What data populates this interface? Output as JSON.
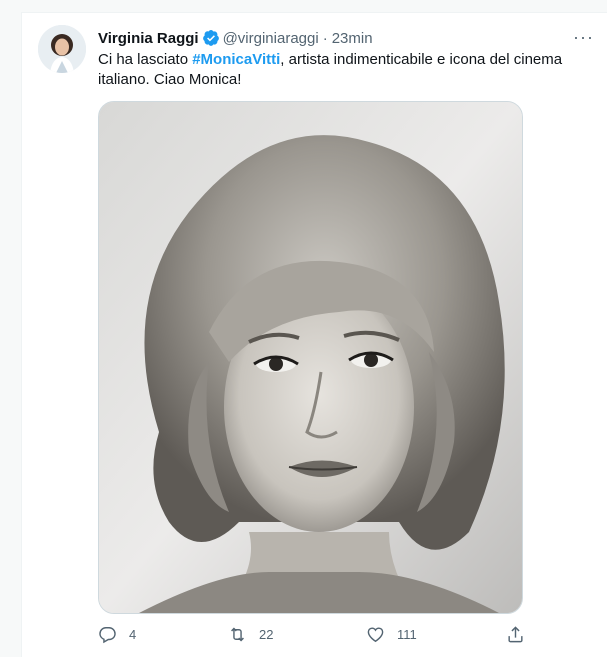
{
  "tweet": {
    "author_name": "Virginia Raggi",
    "author_handle": "@virginiaraggi",
    "separator": "·",
    "time": "23min",
    "text_before": "Ci ha lasciato ",
    "hashtag": "#MonicaVitti",
    "text_after": ", artista indimenticabile e icona del cinema italiano. Ciao Monica!",
    "media_icon": "photo-portrait-black-and-white",
    "more_label": "···"
  },
  "actions": {
    "reply_count": "4",
    "retweet_count": "22",
    "like_count": "111",
    "reply_icon": "reply-icon",
    "retweet_icon": "retweet-icon",
    "like_icon": "heart-icon",
    "share_icon": "share-icon"
  },
  "colors": {
    "link": "#1d9bf0",
    "verified": "#1d9bf0",
    "secondary_text": "#536471"
  }
}
